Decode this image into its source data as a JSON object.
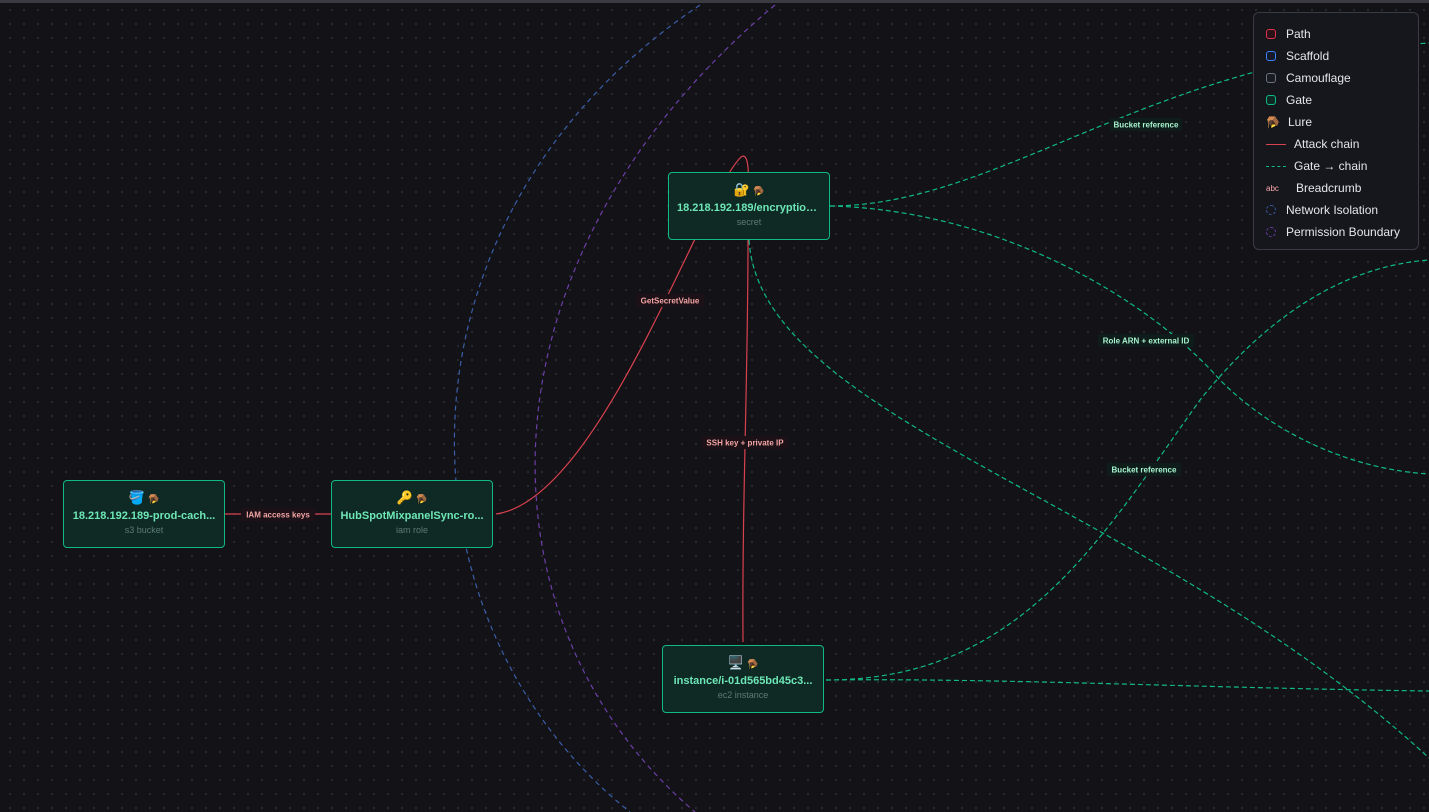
{
  "nodes": {
    "secret": {
      "icon": "🔐",
      "lure_icon": "🪤",
      "title": "18.218.192.189/encryption...",
      "type": "secret"
    },
    "s3": {
      "icon": "🪣",
      "lure_icon": "🪤",
      "title": "18.218.192.189-prod-cach...",
      "type": "s3 bucket"
    },
    "role": {
      "icon": "🔑",
      "lure_icon": "🪤",
      "title": "HubSpotMixpanelSync-ro...",
      "type": "iam role"
    },
    "ec2": {
      "icon": "🖥️",
      "lure_icon": "🪤",
      "title": "instance/i-01d565bd45c3...",
      "type": "ec2 instance"
    }
  },
  "edges": {
    "iam_keys": "IAM access keys",
    "get_secret": "GetSecretValue",
    "ssh": "SSH key + private IP",
    "bucket_ref_1": "Bucket reference",
    "role_arn": "Role ARN + external ID",
    "bucket_ref_2": "Bucket reference"
  },
  "legend": {
    "path": "Path",
    "scaffold": "Scaffold",
    "camouflage": "Camouflage",
    "gate": "Gate",
    "lure": "Lure",
    "lure_icon": "🪤",
    "attack_chain": "Attack chain",
    "gate_chain": "Gate → chain",
    "breadcrumb": "Breadcrumb",
    "breadcrumb_sample": "abc",
    "network_isolation": "Network Isolation",
    "permission_boundary": "Permission Boundary"
  },
  "colors": {
    "attack_chain": "#d9414f",
    "gate_chain": "#10b981",
    "network_isolation": "#3b5ea8",
    "permission_boundary": "#6d3fa8",
    "path": "#e0314a",
    "scaffold": "#3b82f6",
    "camouflage": "#6b7280",
    "gate": "#10b981"
  }
}
